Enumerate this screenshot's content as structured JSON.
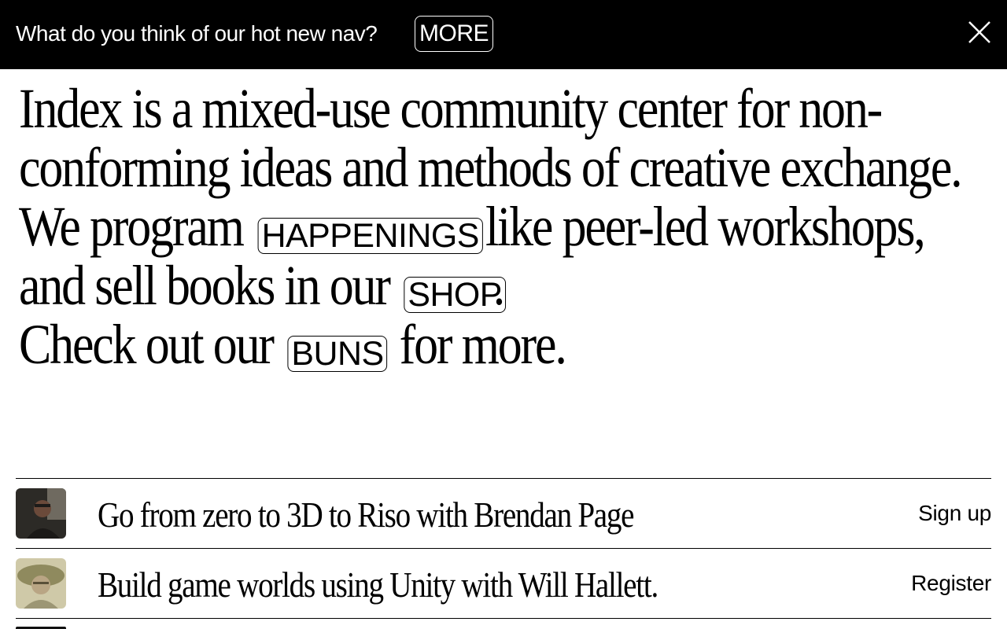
{
  "banner": {
    "question": "What do you think of our hot new nav?",
    "more_label": "MORE",
    "close_icon": "close-icon"
  },
  "hero": {
    "part1": "Index is a mixed-use community center for non-conforming ideas and methods of creative exchange. We program",
    "happenings_label": "HAPPENINGS",
    "part2": "like peer-led workshops, and sell books in our",
    "shop_label": "SHOP",
    "part3": ".",
    "part4": "Check out our",
    "buns_label": "BUNS",
    "part5": "for more."
  },
  "events": [
    {
      "title": "Go from zero to 3D to Riso with Brendan Page",
      "action": "Sign up",
      "thumb_icon": "portrait-brendan-page"
    },
    {
      "title": "Build game worlds using Unity with Will Hallett.",
      "action": "Register",
      "thumb_icon": "portrait-will-hallett"
    }
  ]
}
